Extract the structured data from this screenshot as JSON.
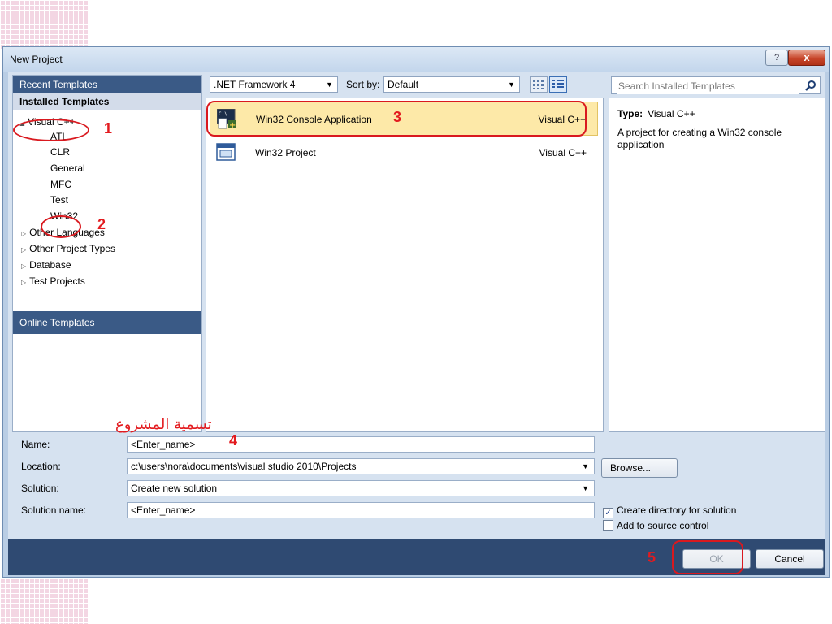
{
  "window": {
    "title": "New Project",
    "help_glyph": "?",
    "close_glyph": "x"
  },
  "left": {
    "recent_templates": "Recent Templates",
    "installed_templates": "Installed Templates",
    "tree": {
      "visual_cpp": "Visual C++",
      "children": [
        "ATL",
        "CLR",
        "General",
        "MFC",
        "Test",
        "Win32"
      ],
      "others": [
        "Other Languages",
        "Other Project Types",
        "Database",
        "Test Projects"
      ]
    },
    "online_templates": "Online Templates"
  },
  "toolbar": {
    "framework": ".NET Framework 4",
    "sort_label": "Sort by:",
    "sort_value": "Default"
  },
  "templates": [
    {
      "name": "Win32 Console Application",
      "lang": "Visual C++",
      "selected": true
    },
    {
      "name": "Win32 Project",
      "lang": "Visual C++",
      "selected": false
    }
  ],
  "search": {
    "placeholder": "Search Installed Templates"
  },
  "details": {
    "type_label": "Type:",
    "type_value": "Visual C++",
    "description": "A project for creating a Win32 console application"
  },
  "form": {
    "name_label": "Name:",
    "name_value": "<Enter_name>",
    "location_label": "Location:",
    "location_value": "c:\\users\\nora\\documents\\visual studio 2010\\Projects",
    "solution_label": "Solution:",
    "solution_value": "Create new solution",
    "solution_name_label": "Solution name:",
    "solution_name_value": "<Enter_name>",
    "browse_label": "Browse...",
    "create_dir_label": "Create directory for solution",
    "create_dir_checked": true,
    "source_control_label": "Add to source control",
    "source_control_checked": false
  },
  "buttons": {
    "ok": "OK",
    "cancel": "Cancel"
  },
  "annotations": {
    "n1": "1",
    "n2": "2",
    "n3": "3",
    "n4": "4",
    "n5": "5",
    "arabic": "تسمية المشروع",
    "color": "#e31b1f"
  },
  "colors": {
    "panel_header": "#3a5a86",
    "selected_row": "#fde9a8",
    "bottom_bar": "#2f4a72"
  }
}
